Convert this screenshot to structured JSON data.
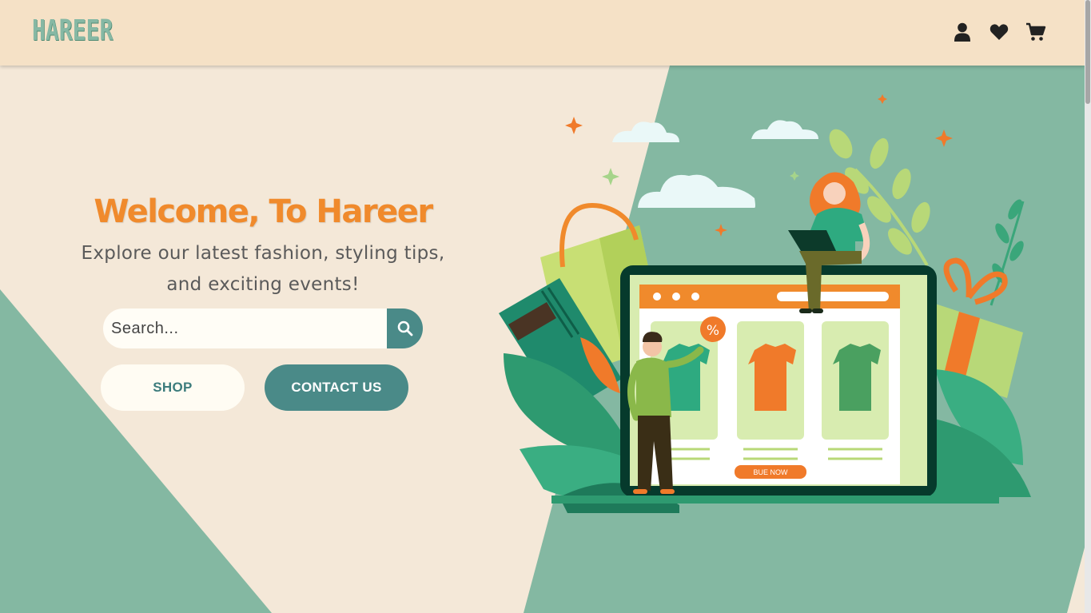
{
  "brand": {
    "logo_text": "HAREER"
  },
  "nav": {
    "icons": [
      "user-icon",
      "heart-icon",
      "cart-icon"
    ]
  },
  "hero": {
    "title": "Welcome, To Hareer",
    "subtitle_line1": "Explore our latest fashion, styling tips,",
    "subtitle_line2": "and exciting events!",
    "search_placeholder": "Search...",
    "shop_label": "SHOP",
    "contact_label": "CONTACT US",
    "illustration_button_label": "BUE NOW",
    "discount_badge": "%"
  },
  "colors": {
    "nav_bg": "#f5e1c6",
    "page_bg": "#f4e8d8",
    "accent_green": "#84b8a2",
    "teal_button": "#4a8a88",
    "title_orange": "#f08a2c"
  }
}
